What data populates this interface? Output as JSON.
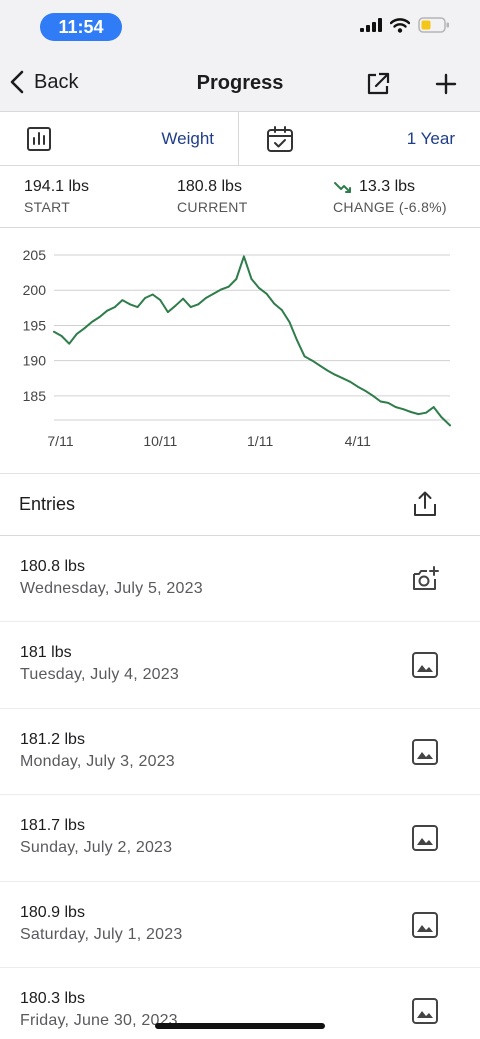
{
  "status": {
    "time": "11:54"
  },
  "nav": {
    "back_label": "Back",
    "title": "Progress"
  },
  "selectors": {
    "metric": "Weight",
    "range": "1 Year"
  },
  "summary": {
    "start": {
      "value": "194.1 lbs",
      "label": "START"
    },
    "current": {
      "value": "180.8 lbs",
      "label": "CURRENT"
    },
    "change": {
      "value": "13.3 lbs",
      "label": "CHANGE (-6.8%)"
    }
  },
  "chart_data": {
    "type": "line",
    "ylim": [
      181,
      206
    ],
    "y_ticks": [
      205,
      200,
      195,
      190,
      185
    ],
    "x_tick_labels": [
      "7/11",
      "10/11",
      "1/11",
      "4/11"
    ],
    "grid": true,
    "color": "#2e7d4a",
    "series": [
      {
        "x": [
          "2022-07-05",
          "2022-07-12",
          "2022-07-19",
          "2022-07-26",
          "2022-08-02",
          "2022-08-09",
          "2022-08-16",
          "2022-08-23",
          "2022-08-30",
          "2022-09-06",
          "2022-09-13",
          "2022-09-20",
          "2022-09-27",
          "2022-10-04",
          "2022-10-11",
          "2022-10-18",
          "2022-10-25",
          "2022-11-01",
          "2022-11-08",
          "2022-11-15",
          "2022-11-22",
          "2022-11-29",
          "2022-12-06",
          "2022-12-13",
          "2022-12-20",
          "2022-12-27",
          "2023-01-03",
          "2023-01-10",
          "2023-01-17",
          "2023-01-24",
          "2023-01-31",
          "2023-02-07",
          "2023-02-14",
          "2023-02-21",
          "2023-02-28",
          "2023-03-07",
          "2023-03-14",
          "2023-03-21",
          "2023-03-28",
          "2023-04-04",
          "2023-04-11",
          "2023-04-18",
          "2023-04-25",
          "2023-05-02",
          "2023-05-09",
          "2023-05-16",
          "2023-05-23",
          "2023-05-30",
          "2023-06-06",
          "2023-06-13",
          "2023-06-20",
          "2023-06-27",
          "2023-07-05"
        ],
        "values": [
          194.1,
          193.5,
          192.4,
          193.8,
          194.6,
          195.5,
          196.2,
          197.1,
          197.6,
          198.6,
          198.0,
          197.6,
          198.9,
          199.4,
          198.6,
          196.9,
          197.8,
          198.8,
          197.6,
          198.0,
          198.9,
          199.5,
          200.1,
          200.5,
          201.6,
          204.8,
          201.6,
          200.3,
          199.5,
          198.1,
          197.2,
          195.5,
          192.9,
          190.6,
          190.0,
          189.3,
          188.6,
          188.0,
          187.5,
          187.0,
          186.3,
          185.7,
          185.0,
          184.2,
          184.0,
          183.4,
          183.1,
          182.7,
          182.4,
          182.6,
          183.4,
          182.0,
          180.8
        ]
      }
    ]
  },
  "entries": {
    "title": "Entries",
    "items": [
      {
        "weight": "180.8 lbs",
        "date": "Wednesday, July 5, 2023",
        "icon": "add-photo-icon"
      },
      {
        "weight": "181 lbs",
        "date": "Tuesday, July 4, 2023",
        "icon": "photo-icon"
      },
      {
        "weight": "181.2 lbs",
        "date": "Monday, July 3, 2023",
        "icon": "photo-icon"
      },
      {
        "weight": "181.7 lbs",
        "date": "Sunday, July 2, 2023",
        "icon": "photo-icon"
      },
      {
        "weight": "180.9 lbs",
        "date": "Saturday, July 1, 2023",
        "icon": "photo-icon"
      },
      {
        "weight": "180.3 lbs",
        "date": "Friday, June 30, 2023",
        "icon": "photo-icon"
      }
    ]
  },
  "colors": {
    "accent": "#1f3e8a",
    "line": "#2e7d4a",
    "time_pill": "#2f7cf6"
  }
}
